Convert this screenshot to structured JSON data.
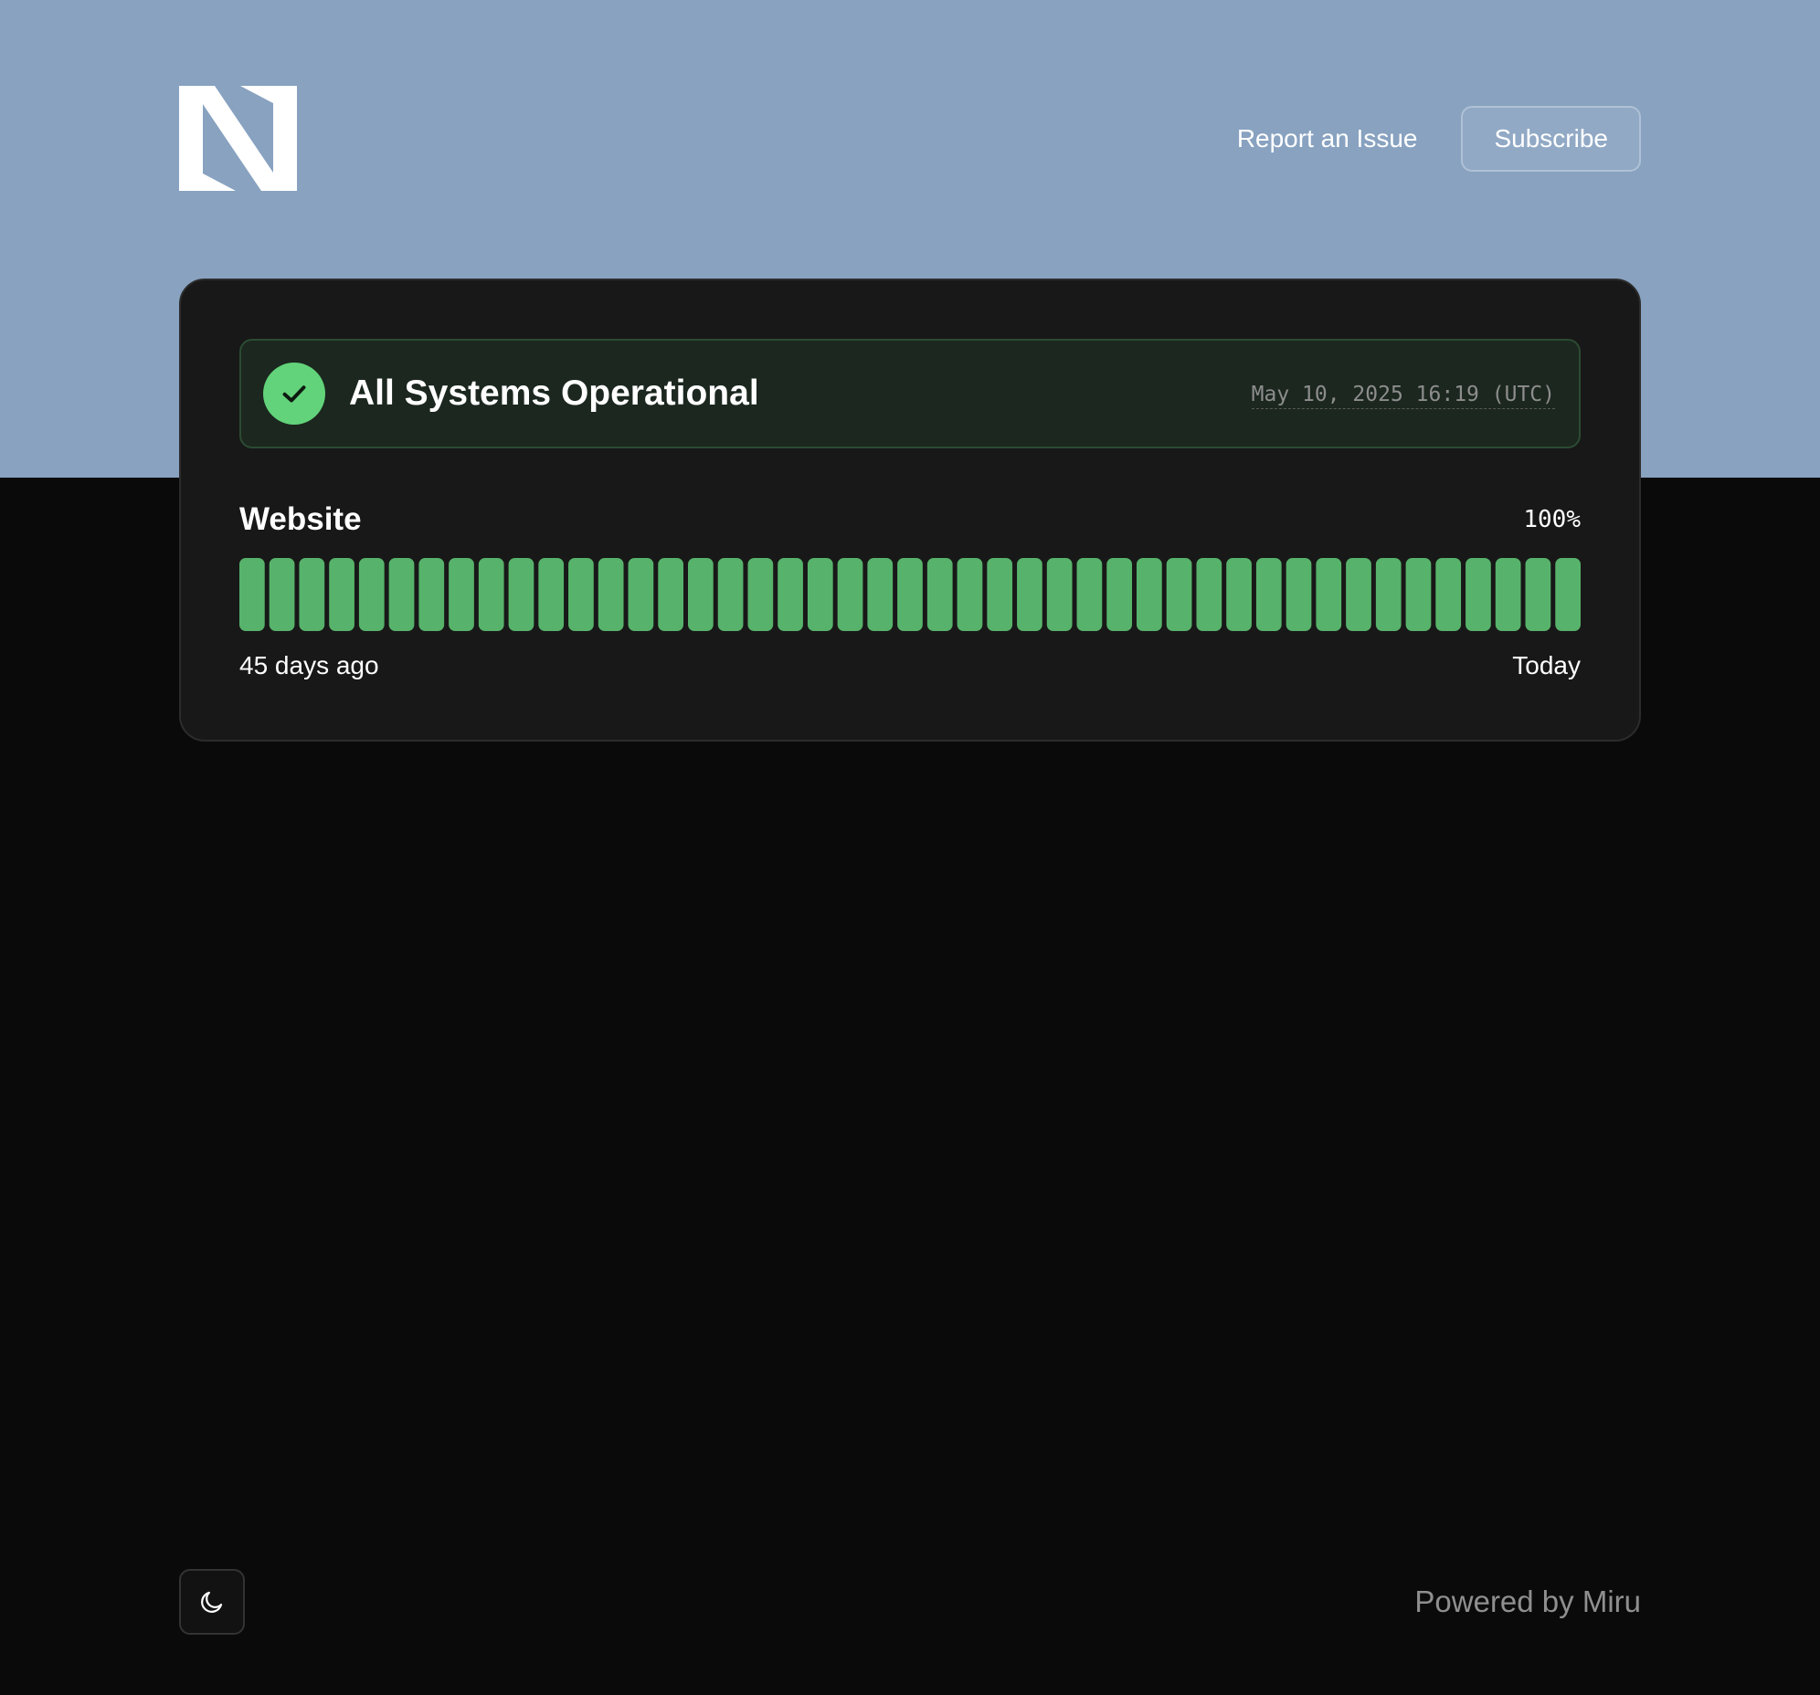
{
  "header": {
    "logo_icon": "stylized-n-logo",
    "report_link": "Report an Issue",
    "subscribe_button": "Subscribe",
    "hero_color": "#88a2c0"
  },
  "status": {
    "title": "All Systems Operational",
    "icon": "check-icon",
    "timestamp": "May 10, 2025 16:19 (UTC)",
    "color": "#62d37a"
  },
  "services": [
    {
      "name": "Website",
      "uptime": "100%",
      "range_start": "45 days ago",
      "range_end": "Today",
      "days": 45,
      "operational_color": "#57b36b"
    }
  ],
  "footer": {
    "theme_toggle_icon": "moon-icon",
    "powered_by": "Powered by Miru"
  }
}
